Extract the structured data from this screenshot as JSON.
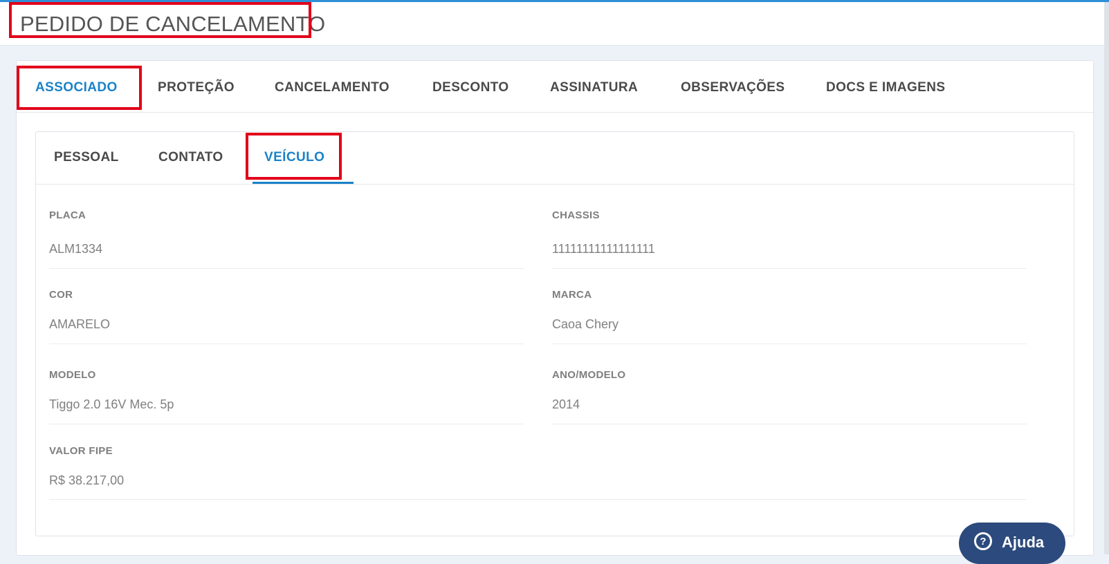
{
  "header": {
    "title": "PEDIDO DE CANCELAMENTO"
  },
  "main_tabs": [
    {
      "label": "ASSOCIADO",
      "active": true
    },
    {
      "label": "PROTEÇÃO",
      "active": false
    },
    {
      "label": "CANCELAMENTO",
      "active": false
    },
    {
      "label": "DESCONTO",
      "active": false
    },
    {
      "label": "ASSINATURA",
      "active": false
    },
    {
      "label": "OBSERVAÇÕES",
      "active": false
    },
    {
      "label": "DOCS E IMAGENS",
      "active": false
    }
  ],
  "sub_tabs": [
    {
      "label": "PESSOAL",
      "active": false
    },
    {
      "label": "CONTATO",
      "active": false
    },
    {
      "label": "VEÍCULO",
      "active": true
    }
  ],
  "vehicle": {
    "placa": {
      "label": "PLACA",
      "value": "ALM1334"
    },
    "chassis": {
      "label": "CHASSIS",
      "value": "11111111111111111"
    },
    "cor": {
      "label": "COR",
      "value": "AMARELO"
    },
    "marca": {
      "label": "MARCA",
      "value": "Caoa Chery"
    },
    "modelo": {
      "label": "MODELO",
      "value": "Tiggo 2.0 16V Mec. 5p"
    },
    "ano_modelo": {
      "label": "ANO/MODELO",
      "value": "2014"
    },
    "valor_fipe": {
      "label": "VALOR FIPE",
      "value": "R$ 38.217,00"
    }
  },
  "help": {
    "label": "Ajuda",
    "icon": "question-circle-icon"
  },
  "colors": {
    "accent": "#1a82c8",
    "highlight": "#e2001a",
    "help_bg": "#2c4a7d"
  }
}
